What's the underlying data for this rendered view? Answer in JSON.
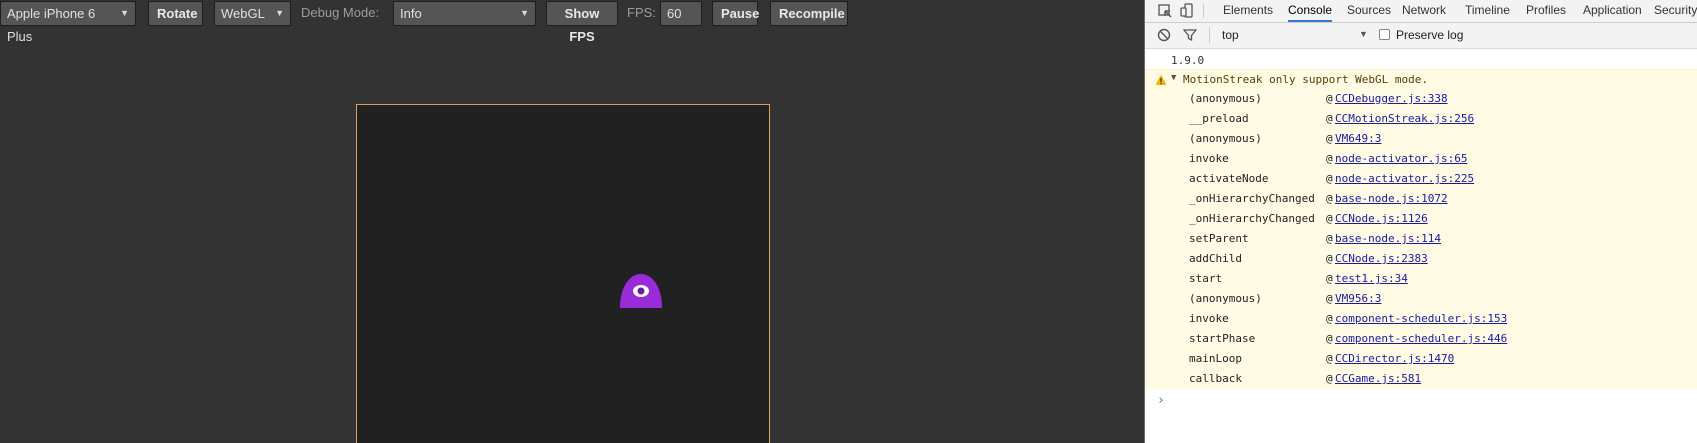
{
  "toolbar": {
    "device": "Apple iPhone 6 Plus",
    "rotate": "Rotate",
    "renderer": "WebGL",
    "debug_label": "Debug Mode:",
    "debug_value": "Info",
    "show_fps": "Show FPS",
    "fps_label": "FPS:",
    "fps_value": "60",
    "pause": "Pause",
    "recompile": "Recompile"
  },
  "devtools": {
    "tabs": [
      "Elements",
      "Console",
      "Sources",
      "Network",
      "Timeline",
      "Profiles",
      "Application",
      "Security"
    ],
    "active_tab": "Console",
    "context": "top",
    "preserve_log": "Preserve log",
    "console": {
      "version": "1.9.0",
      "warning": "MotionStreak only support WebGL mode.",
      "frames": [
        {
          "fn": "(anonymous)",
          "src": "CCDebugger.js:338"
        },
        {
          "fn": "__preload",
          "src": "CCMotionStreak.js:256"
        },
        {
          "fn": "(anonymous)",
          "src": "VM649:3"
        },
        {
          "fn": "invoke",
          "src": "node-activator.js:65"
        },
        {
          "fn": "activateNode",
          "src": "node-activator.js:225"
        },
        {
          "fn": "_onHierarchyChanged",
          "src": "base-node.js:1072"
        },
        {
          "fn": "_onHierarchyChanged",
          "src": "CCNode.js:1126"
        },
        {
          "fn": "setParent",
          "src": "base-node.js:114"
        },
        {
          "fn": "addChild",
          "src": "CCNode.js:2383"
        },
        {
          "fn": "start",
          "src": "test1.js:34"
        },
        {
          "fn": "(anonymous)",
          "src": "VM956:3"
        },
        {
          "fn": "invoke",
          "src": "component-scheduler.js:153"
        },
        {
          "fn": "startPhase",
          "src": "component-scheduler.js:446"
        },
        {
          "fn": "mainLoop",
          "src": "CCDirector.js:1470"
        },
        {
          "fn": "callback",
          "src": "CCGame.js:581"
        }
      ]
    }
  },
  "colors": {
    "canvas_border": "#d9a35a",
    "sprite": "#9a2bd9",
    "link": "#1a1aa6",
    "active_tab_underline": "#3879d9",
    "warning_bg": "#fffbe5"
  }
}
